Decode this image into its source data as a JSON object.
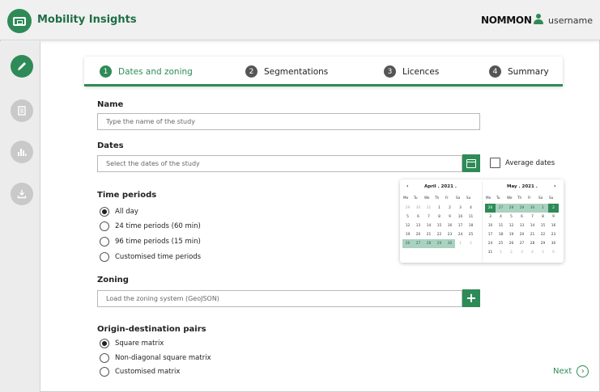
{
  "header": {
    "app_title": "Mobility Insights",
    "brand": "NOMMON",
    "username": "username",
    "accent_color": "#2e8b57"
  },
  "sidebar": {
    "items": [
      {
        "icon": "pencil-icon",
        "active": true
      },
      {
        "icon": "document-icon",
        "active": false
      },
      {
        "icon": "bar-chart-icon",
        "active": false
      },
      {
        "icon": "download-icon",
        "active": false
      }
    ]
  },
  "steps": [
    {
      "num": "1",
      "label": "Dates and zoning",
      "active": true
    },
    {
      "num": "2",
      "label": "Segmentations",
      "active": false
    },
    {
      "num": "3",
      "label": "Licences",
      "active": false
    },
    {
      "num": "4",
      "label": "Summary",
      "active": false
    }
  ],
  "form": {
    "name_label": "Name",
    "name_placeholder": "Type the name of the study",
    "dates_label": "Dates",
    "dates_placeholder": "Select the dates of the study",
    "average_dates_label": "Average dates",
    "time_periods_label": "Time periods",
    "time_periods": [
      {
        "label": "All day",
        "selected": true
      },
      {
        "label": "24 time periods (60 min)",
        "selected": false
      },
      {
        "label": "96 time periods (15 min)",
        "selected": false
      },
      {
        "label": "Customised time periods",
        "selected": false
      }
    ],
    "zoning_label": "Zoning",
    "zoning_placeholder": "Load the zoning system (GeoJSON)",
    "od_label": "Origin-destination pairs",
    "od_options": [
      {
        "label": "Square matrix",
        "selected": true
      },
      {
        "label": "Non-diagonal square matrix",
        "selected": false
      },
      {
        "label": "Customised matrix",
        "selected": false
      }
    ],
    "next_label": "Next"
  },
  "calendar": {
    "dow": [
      "Mo",
      "Tu",
      "We",
      "Th",
      "Fr",
      "Sa",
      "Su"
    ],
    "left": {
      "title": "April .  2021 .",
      "prev": "‹",
      "days": [
        {
          "d": "29",
          "s": "muted"
        },
        {
          "d": "30",
          "s": "muted"
        },
        {
          "d": "31",
          "s": "muted"
        },
        {
          "d": "1",
          "s": ""
        },
        {
          "d": "2",
          "s": ""
        },
        {
          "d": "3",
          "s": ""
        },
        {
          "d": "4",
          "s": ""
        },
        {
          "d": "5",
          "s": ""
        },
        {
          "d": "6",
          "s": ""
        },
        {
          "d": "7",
          "s": ""
        },
        {
          "d": "8",
          "s": ""
        },
        {
          "d": "9",
          "s": ""
        },
        {
          "d": "10",
          "s": ""
        },
        {
          "d": "11",
          "s": ""
        },
        {
          "d": "12",
          "s": ""
        },
        {
          "d": "13",
          "s": ""
        },
        {
          "d": "14",
          "s": ""
        },
        {
          "d": "15",
          "s": ""
        },
        {
          "d": "16",
          "s": ""
        },
        {
          "d": "17",
          "s": ""
        },
        {
          "d": "18",
          "s": ""
        },
        {
          "d": "19",
          "s": ""
        },
        {
          "d": "20",
          "s": ""
        },
        {
          "d": "21",
          "s": ""
        },
        {
          "d": "22",
          "s": ""
        },
        {
          "d": "23",
          "s": ""
        },
        {
          "d": "24",
          "s": ""
        },
        {
          "d": "25",
          "s": ""
        },
        {
          "d": "26",
          "s": "range"
        },
        {
          "d": "27",
          "s": "range"
        },
        {
          "d": "28",
          "s": "range"
        },
        {
          "d": "29",
          "s": "range"
        },
        {
          "d": "30",
          "s": "range"
        },
        {
          "d": "1",
          "s": "muted"
        },
        {
          "d": "2",
          "s": "muted"
        }
      ]
    },
    "right": {
      "title": "May .  2021 .",
      "next": "›",
      "days": [
        {
          "d": "26",
          "s": "sel"
        },
        {
          "d": "27",
          "s": "range"
        },
        {
          "d": "28",
          "s": "range"
        },
        {
          "d": "29",
          "s": "range"
        },
        {
          "d": "30",
          "s": "range"
        },
        {
          "d": "1",
          "s": "range"
        },
        {
          "d": "2",
          "s": "sel"
        },
        {
          "d": "3",
          "s": ""
        },
        {
          "d": "4",
          "s": ""
        },
        {
          "d": "5",
          "s": ""
        },
        {
          "d": "6",
          "s": ""
        },
        {
          "d": "7",
          "s": ""
        },
        {
          "d": "8",
          "s": ""
        },
        {
          "d": "9",
          "s": ""
        },
        {
          "d": "10",
          "s": ""
        },
        {
          "d": "11",
          "s": ""
        },
        {
          "d": "12",
          "s": ""
        },
        {
          "d": "13",
          "s": ""
        },
        {
          "d": "14",
          "s": ""
        },
        {
          "d": "15",
          "s": ""
        },
        {
          "d": "16",
          "s": ""
        },
        {
          "d": "17",
          "s": ""
        },
        {
          "d": "18",
          "s": ""
        },
        {
          "d": "19",
          "s": ""
        },
        {
          "d": "20",
          "s": ""
        },
        {
          "d": "21",
          "s": ""
        },
        {
          "d": "22",
          "s": ""
        },
        {
          "d": "23",
          "s": ""
        },
        {
          "d": "24",
          "s": ""
        },
        {
          "d": "25",
          "s": ""
        },
        {
          "d": "26",
          "s": ""
        },
        {
          "d": "27",
          "s": ""
        },
        {
          "d": "28",
          "s": ""
        },
        {
          "d": "29",
          "s": ""
        },
        {
          "d": "30",
          "s": ""
        },
        {
          "d": "31",
          "s": ""
        },
        {
          "d": "1",
          "s": "muted"
        },
        {
          "d": "2",
          "s": "muted"
        },
        {
          "d": "3",
          "s": "muted"
        },
        {
          "d": "4",
          "s": "muted"
        },
        {
          "d": "5",
          "s": "muted"
        },
        {
          "d": "6",
          "s": "muted"
        }
      ]
    }
  }
}
